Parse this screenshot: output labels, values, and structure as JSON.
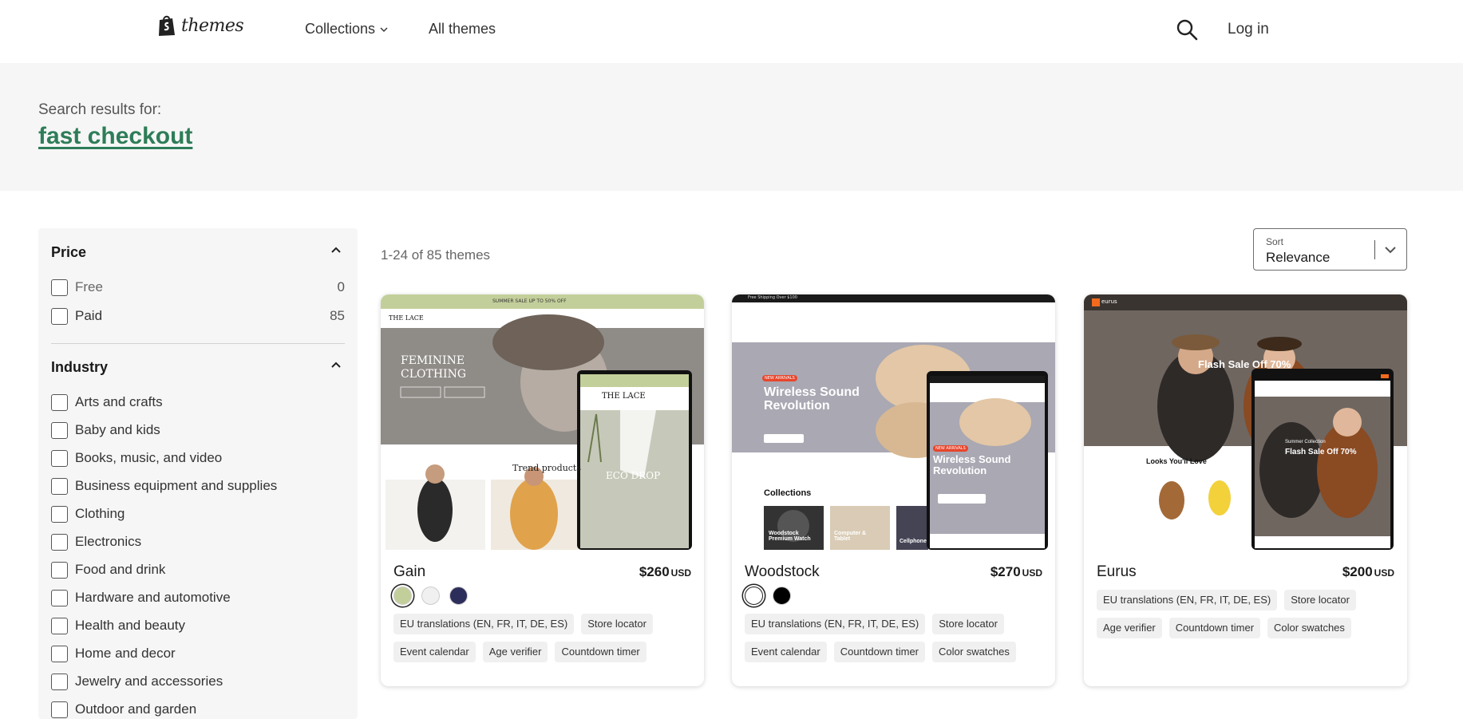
{
  "header": {
    "logo_text": "themes",
    "nav": [
      {
        "label": "Collections"
      },
      {
        "label": "All themes"
      }
    ],
    "login_label": "Log in"
  },
  "search": {
    "label": "Search results for:",
    "query": "fast checkout"
  },
  "filters": {
    "price": {
      "title": "Price",
      "options": [
        {
          "label": "Free",
          "count": "0"
        },
        {
          "label": "Paid",
          "count": "85"
        }
      ]
    },
    "industry": {
      "title": "Industry",
      "options": [
        {
          "label": "Arts and crafts"
        },
        {
          "label": "Baby and kids"
        },
        {
          "label": "Books, music, and video"
        },
        {
          "label": "Business equipment and supplies"
        },
        {
          "label": "Clothing"
        },
        {
          "label": "Electronics"
        },
        {
          "label": "Food and drink"
        },
        {
          "label": "Hardware and automotive"
        },
        {
          "label": "Health and beauty"
        },
        {
          "label": "Home and decor"
        },
        {
          "label": "Jewelry and accessories"
        },
        {
          "label": "Outdoor and garden"
        }
      ]
    }
  },
  "results": {
    "count_text": "1-24 of 85 themes",
    "sort": {
      "label": "Sort",
      "value": "Relevance"
    }
  },
  "themes": [
    {
      "name": "Gain",
      "price": "$260",
      "currency": "USD",
      "swatches": [
        "#c3cf9a",
        "#f0f0f0",
        "#2c2d5a"
      ],
      "features": [
        "EU translations (EN, FR, IT, DE, ES)",
        "Store locator",
        "Event calendar",
        "Age verifier",
        "Countdown timer"
      ],
      "preview": {
        "promo": "SUMMER SALE UP TO 50% OFF",
        "brand": "THE LACE",
        "hero": "FEMININE CLOTHING",
        "section": "Trend products",
        "mobile_hero": "ECO DROP",
        "accent": "#c3cf9a"
      }
    },
    {
      "name": "Woodstock",
      "price": "$270",
      "currency": "USD",
      "swatches": [
        "#ffffff",
        "#000000"
      ],
      "features": [
        "EU translations (EN, FR, IT, DE, ES)",
        "Store locator",
        "Event calendar",
        "Countdown timer",
        "Color swatches"
      ],
      "preview": {
        "promo": "Free Shipping Over $100",
        "hero": "Wireless Sound Revolution",
        "section": "Collections",
        "tile1": "Woodstock Premium Watch",
        "tile2": "Computer & Tablet",
        "tile3": "Cellphone",
        "badge": "NEW ARRIVALS",
        "accent": "#e8452c"
      }
    },
    {
      "name": "Eurus",
      "price": "$200",
      "currency": "USD",
      "swatches": [],
      "features": [
        "EU translations (EN, FR, IT, DE, ES)",
        "Store locator",
        "Age verifier",
        "Countdown timer",
        "Color swatches"
      ],
      "preview": {
        "brand": "eurus",
        "hero": "Flash Sale Off 70%",
        "section": "Looks You'll Love",
        "mobile_kicker": "Summer Collection",
        "mobile_hero": "Flash Sale Off 70%",
        "accent": "#f26b1d"
      }
    }
  ]
}
